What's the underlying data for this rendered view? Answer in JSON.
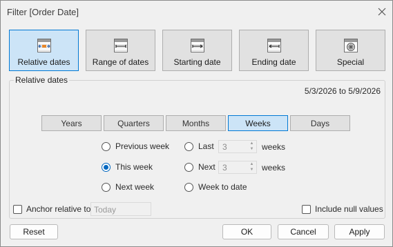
{
  "window": {
    "title": "Filter [Order Date]"
  },
  "range_buttons": [
    {
      "label": "Relative dates",
      "icon": "relative-dates-icon",
      "selected": true
    },
    {
      "label": "Range of dates",
      "icon": "range-of-dates-icon",
      "selected": false
    },
    {
      "label": "Starting date",
      "icon": "starting-date-icon",
      "selected": false
    },
    {
      "label": "Ending date",
      "icon": "ending-date-icon",
      "selected": false
    },
    {
      "label": "Special",
      "icon": "special-icon",
      "selected": false
    }
  ],
  "relative": {
    "group_title": "Relative dates",
    "date_range": "5/3/2026 to 5/9/2026",
    "units": [
      "Years",
      "Quarters",
      "Months",
      "Weeks",
      "Days"
    ],
    "selected_unit": "Weeks",
    "options": {
      "previous": "Previous week",
      "this": "This week",
      "next": "Next week",
      "last": "Last",
      "next_n": "Next",
      "to_date": "Week to date"
    },
    "selected_option": "This week",
    "last_n": {
      "value": "3",
      "unit": "weeks"
    },
    "next_n": {
      "value": "3",
      "unit": "weeks"
    }
  },
  "anchor": {
    "label": "Anchor relative to",
    "value": "Today",
    "checked": false
  },
  "include_null": {
    "label": "Include null values",
    "checked": false
  },
  "buttons": {
    "reset": "Reset",
    "ok": "OK",
    "cancel": "Cancel",
    "apply": "Apply"
  },
  "colors": {
    "selected_fill": "#cce4f7",
    "selected_border": "#0078d4",
    "radio_accent": "#0067c0"
  }
}
